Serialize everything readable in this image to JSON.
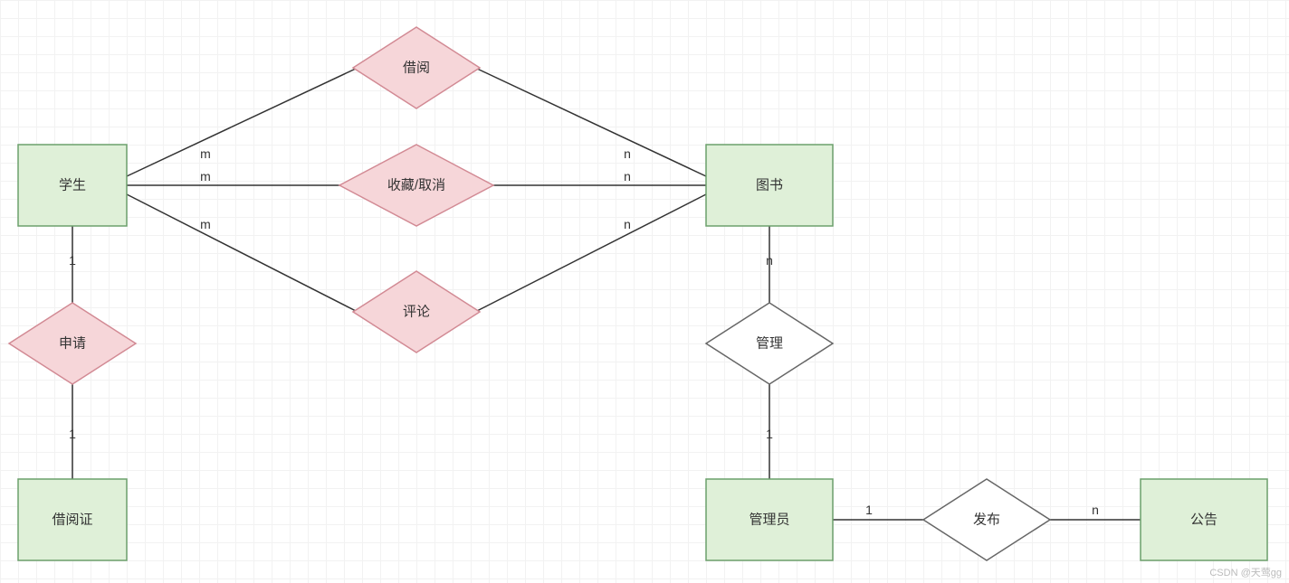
{
  "entities": {
    "student": "学生",
    "book": "图书",
    "card": "借阅证",
    "admin": "管理员",
    "notice": "公告"
  },
  "relations": {
    "borrow": "借阅",
    "favorite": "收藏/取消",
    "comment": "评论",
    "apply": "申请",
    "manage": "管理",
    "publish": "发布"
  },
  "cardinalities": {
    "m": "m",
    "n": "n",
    "one": "1"
  },
  "watermark": "CSDN @天莺gg"
}
